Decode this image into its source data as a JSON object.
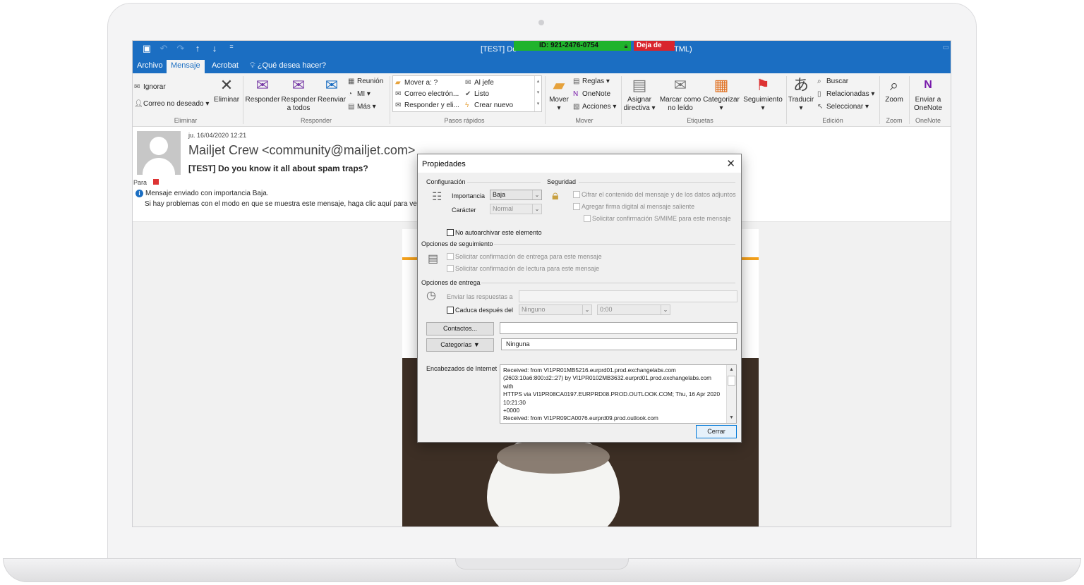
{
  "window": {
    "title_left": "[TEST] Do",
    "title_right": "TML)",
    "teamviewer_id": "ID: 921-2476-0754",
    "teamviewer_stop": "Deja de"
  },
  "tabs": [
    "Archivo",
    "Mensaje",
    "Acrobat",
    "¿Qué desea hacer?"
  ],
  "ribbon": {
    "eliminar": {
      "ignorar": "Ignorar",
      "correo_no_deseado": "Correo no deseado",
      "eliminar": "Eliminar",
      "group": "Eliminar"
    },
    "responder": {
      "responder": "Responder",
      "responder_todos_1": "Responder",
      "responder_todos_2": "a todos",
      "reenviar": "Reenviar",
      "reunion": "Reunión",
      "mi": "MI",
      "mas": "Más",
      "group": "Responder"
    },
    "pasos_rapidos": {
      "items": [
        "Mover a: ?",
        "Correo electrón...",
        "Responder y eli...",
        "Al jefe",
        "Listo",
        "Crear nuevo"
      ],
      "group": "Pasos rápidos"
    },
    "mover": {
      "mover": "Mover",
      "reglas": "Reglas",
      "onenote": "OneNote",
      "acciones": "Acciones",
      "group": "Mover"
    },
    "etiquetas": {
      "asignar_1": "Asignar",
      "asignar_2": "directiva",
      "marcar_1": "Marcar como",
      "marcar_2": "no leído",
      "categorizar": "Categorizar",
      "seguimiento": "Seguimiento",
      "group": "Etiquetas"
    },
    "edicion": {
      "traducir": "Traducir",
      "buscar": "Buscar",
      "relacionadas": "Relacionadas",
      "seleccionar": "Seleccionar",
      "group": "Edición"
    },
    "zoom": {
      "zoom": "Zoom",
      "group": "Zoom"
    },
    "onenote": {
      "enviar_1": "Enviar a",
      "enviar_2": "OneNote",
      "group": "OneNote"
    }
  },
  "message": {
    "date": "ju. 16/04/2020 12:21",
    "from": "Mailjet Crew <community@mailjet.com>",
    "subject": "[TEST] Do you know it all about spam traps? ",
    "to_label": "Para",
    "info_importance": "Mensaje enviado con importancia Baja.",
    "info_display": "Si hay problemas con el modo en que se muestra este mensaje, haga clic aquí para ver"
  },
  "dialog": {
    "title": "Propiedades",
    "configuracion": "Configuración",
    "seguridad": "Seguridad",
    "importancia_label": "Importancia",
    "importancia_value": "Baja",
    "caracter_label": "Carácter",
    "caracter_value": "Normal",
    "cifrar": "Cifrar el contenido del mensaje y de los datos adjuntos",
    "firma": "Agregar firma digital al mensaje saliente",
    "smime": "Solicitar confirmación S/MIME para este mensaje",
    "no_autoarchivar": "No autoarchivar este elemento",
    "opciones_seguimiento": "Opciones de seguimiento",
    "confirmacion_entrega": "Solicitar confirmación de entrega para este mensaje",
    "confirmacion_lectura": "Solicitar confirmación de lectura para este mensaje",
    "opciones_entrega": "Opciones de entrega",
    "enviar_respuestas": "Enviar las respuestas a",
    "caduca": "Caduca después del",
    "caduca_fecha": "Ninguno",
    "caduca_hora": "0:00",
    "contactos": "Contactos...",
    "categorias": "Categorías",
    "categorias_value": "Ninguna",
    "encabezados_label": "Encabezados de Internet",
    "headers": [
      "Received: from VI1PR01MB5216.eurprd01.prod.exchangelabs.com",
      " (2603:10a6:800:d2::27) by VI1PR0102MB3632.eurprd01.prod.exchangelabs.com",
      "with",
      " HTTPS via VI1PR08CA0197.EURPRD08.PROD.OUTLOOK.COM; Thu, 16 Apr 2020",
      "10:21:30",
      " +0000",
      "Received: from VI1PR09CA0076.eurprd09.prod.outlook.com"
    ],
    "cerrar": "Cerrar"
  }
}
